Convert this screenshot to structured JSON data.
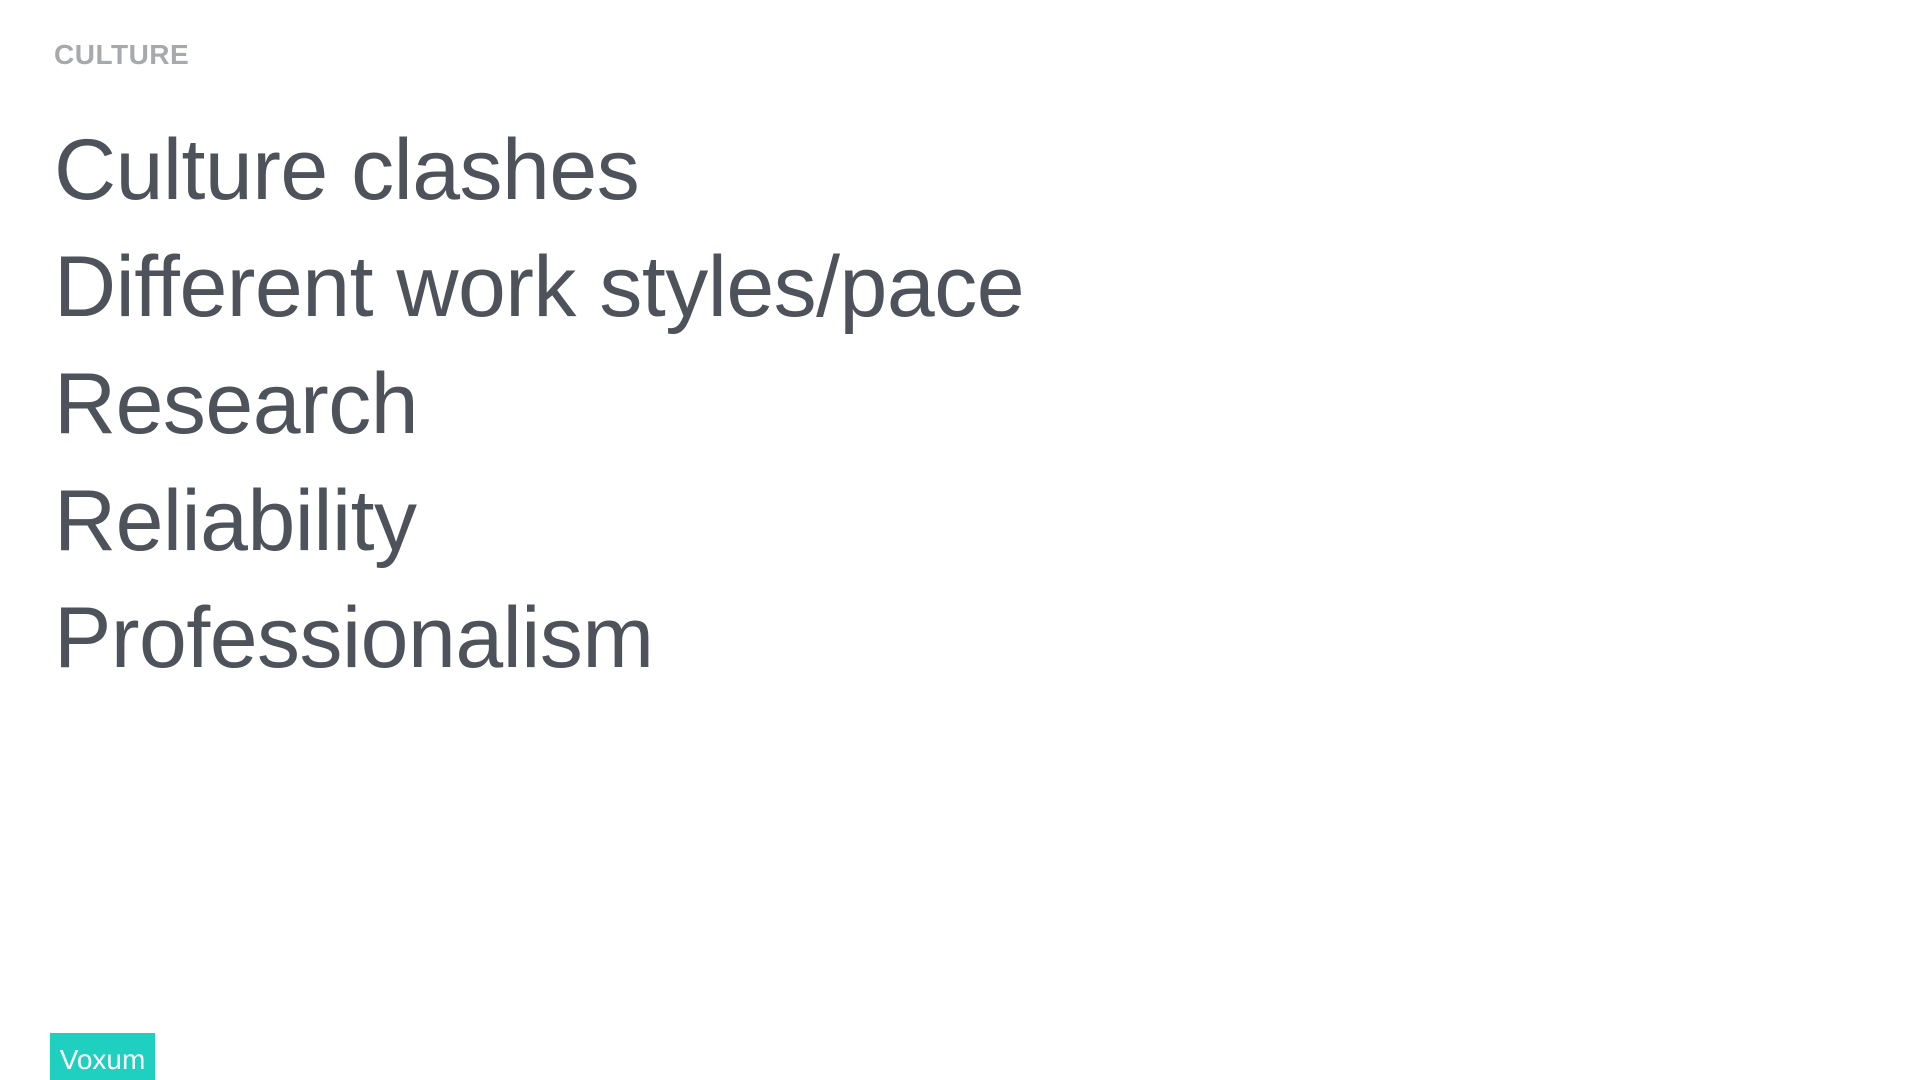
{
  "slide": {
    "section_label": "CULTURE",
    "points": [
      "Culture clashes",
      "Different work styles/pace",
      "Research",
      "Reliability",
      "Professionalism"
    ],
    "brand": "Voxum"
  },
  "colors": {
    "background": "#ffffff",
    "section_label": "#a7a9ac",
    "body_text": "#4e535b",
    "brand_background": "#1fd0c0",
    "brand_text": "#ffffff"
  }
}
